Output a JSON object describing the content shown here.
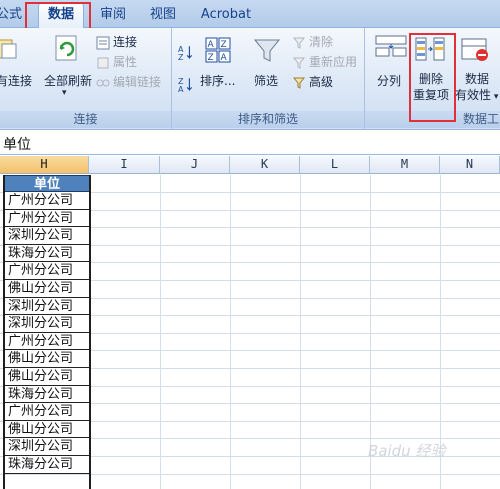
{
  "tabs": [
    "公式",
    "数据",
    "审阅",
    "视图",
    "Acrobat"
  ],
  "ribbon": {
    "conn_group": {
      "cut_btn": "有连接",
      "refresh_all": "全部刷新",
      "connections": "连接",
      "properties": "属性",
      "edit_links": "编辑链接",
      "label": "连接"
    },
    "sort_group": {
      "sort": "排序...",
      "filter": "筛选",
      "clear": "清除",
      "reapply": "重新应用",
      "advanced": "高级",
      "label": "排序和筛选"
    },
    "tools_group": {
      "text_to_cols": "分列",
      "remove_dup_1": "删除",
      "remove_dup_2": "重复项",
      "validation_1": "数据",
      "validation_2": "有效性",
      "label": "数据工"
    }
  },
  "formula_bar": {
    "content": "单位"
  },
  "columns": [
    "H",
    "I",
    "J",
    "K",
    "L",
    "M",
    "N"
  ],
  "column_h": {
    "header": "单位",
    "rows": [
      "广州分公司",
      "广州分公司",
      "深圳分公司",
      "珠海分公司",
      "广州分公司",
      "佛山分公司",
      "深圳分公司",
      "深圳分公司",
      "广州分公司",
      "佛山分公司",
      "佛山分公司",
      "珠海分公司",
      "广州分公司",
      "佛山分公司",
      "深圳分公司",
      "珠海分公司"
    ]
  },
  "watermark": "Baidu 经验",
  "colors": {
    "highlight": "#e0303a",
    "header_fill": "#4f81bd",
    "selected_col": "#f3c06a"
  }
}
